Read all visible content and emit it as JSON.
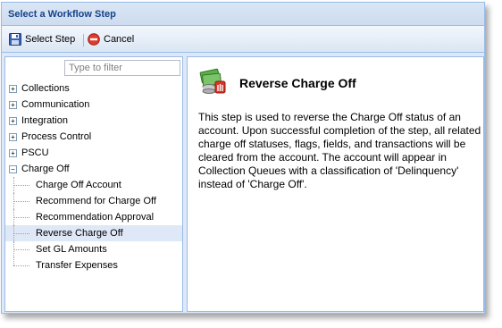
{
  "dialog": {
    "title": "Select a Workflow Step"
  },
  "toolbar": {
    "select_label": "Select Step",
    "cancel_label": "Cancel"
  },
  "filter": {
    "placeholder": "Type to filter"
  },
  "tree": {
    "categories": [
      {
        "label": "Collections",
        "expander": "+"
      },
      {
        "label": "Communication",
        "expander": "+"
      },
      {
        "label": "Integration",
        "expander": "+"
      },
      {
        "label": "Process Control",
        "expander": "+"
      },
      {
        "label": "PSCU",
        "expander": "+"
      },
      {
        "label": "Charge Off",
        "expander": "−"
      }
    ],
    "charge_off_children": [
      {
        "label": "Charge Off Account"
      },
      {
        "label": "Recommend for Charge Off"
      },
      {
        "label": "Recommendation Approval"
      },
      {
        "label": "Reverse Charge Off",
        "selected": true
      },
      {
        "label": "Set GL Amounts"
      },
      {
        "label": "Transfer Expenses"
      }
    ]
  },
  "detail": {
    "icon": "money-stop-icon",
    "title": "Reverse Charge Off",
    "description": "This step is used to reverse the Charge Off status of an account. Upon successful completion of the step, all related charge off statuses, flags, fields, and transactions will be cleared from the account. The account will appear in Collection Queues with a classification of 'Delinquency' instead of 'Charge Off'."
  },
  "colors": {
    "border": "#99bbe8",
    "title_text": "#15428b",
    "selection": "#dfe8f6"
  }
}
